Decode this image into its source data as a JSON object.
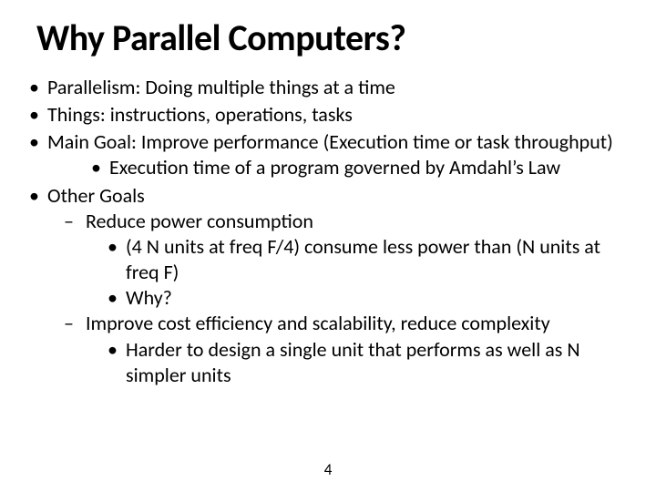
{
  "title": "Why Parallel Computers?",
  "bullets": {
    "b1": "Parallelism: Doing multiple things at a time",
    "b2": "Things: instructions, operations, tasks",
    "b3": "Main Goal: Improve performance (Execution time or task throughput)",
    "b3a": "Execution time of a program governed by Amdahl’s Law",
    "b4": "Other Goals",
    "b4a": "Reduce power consumption",
    "b4a1": "(4 N units at freq F/4) consume less power than (N units at freq F)",
    "b4a2": "Why?",
    "b4b": "Improve cost efficiency and scalability, reduce complexity",
    "b4b1": "Harder to design a single unit that performs as well as N simpler units"
  },
  "page_number": "4"
}
